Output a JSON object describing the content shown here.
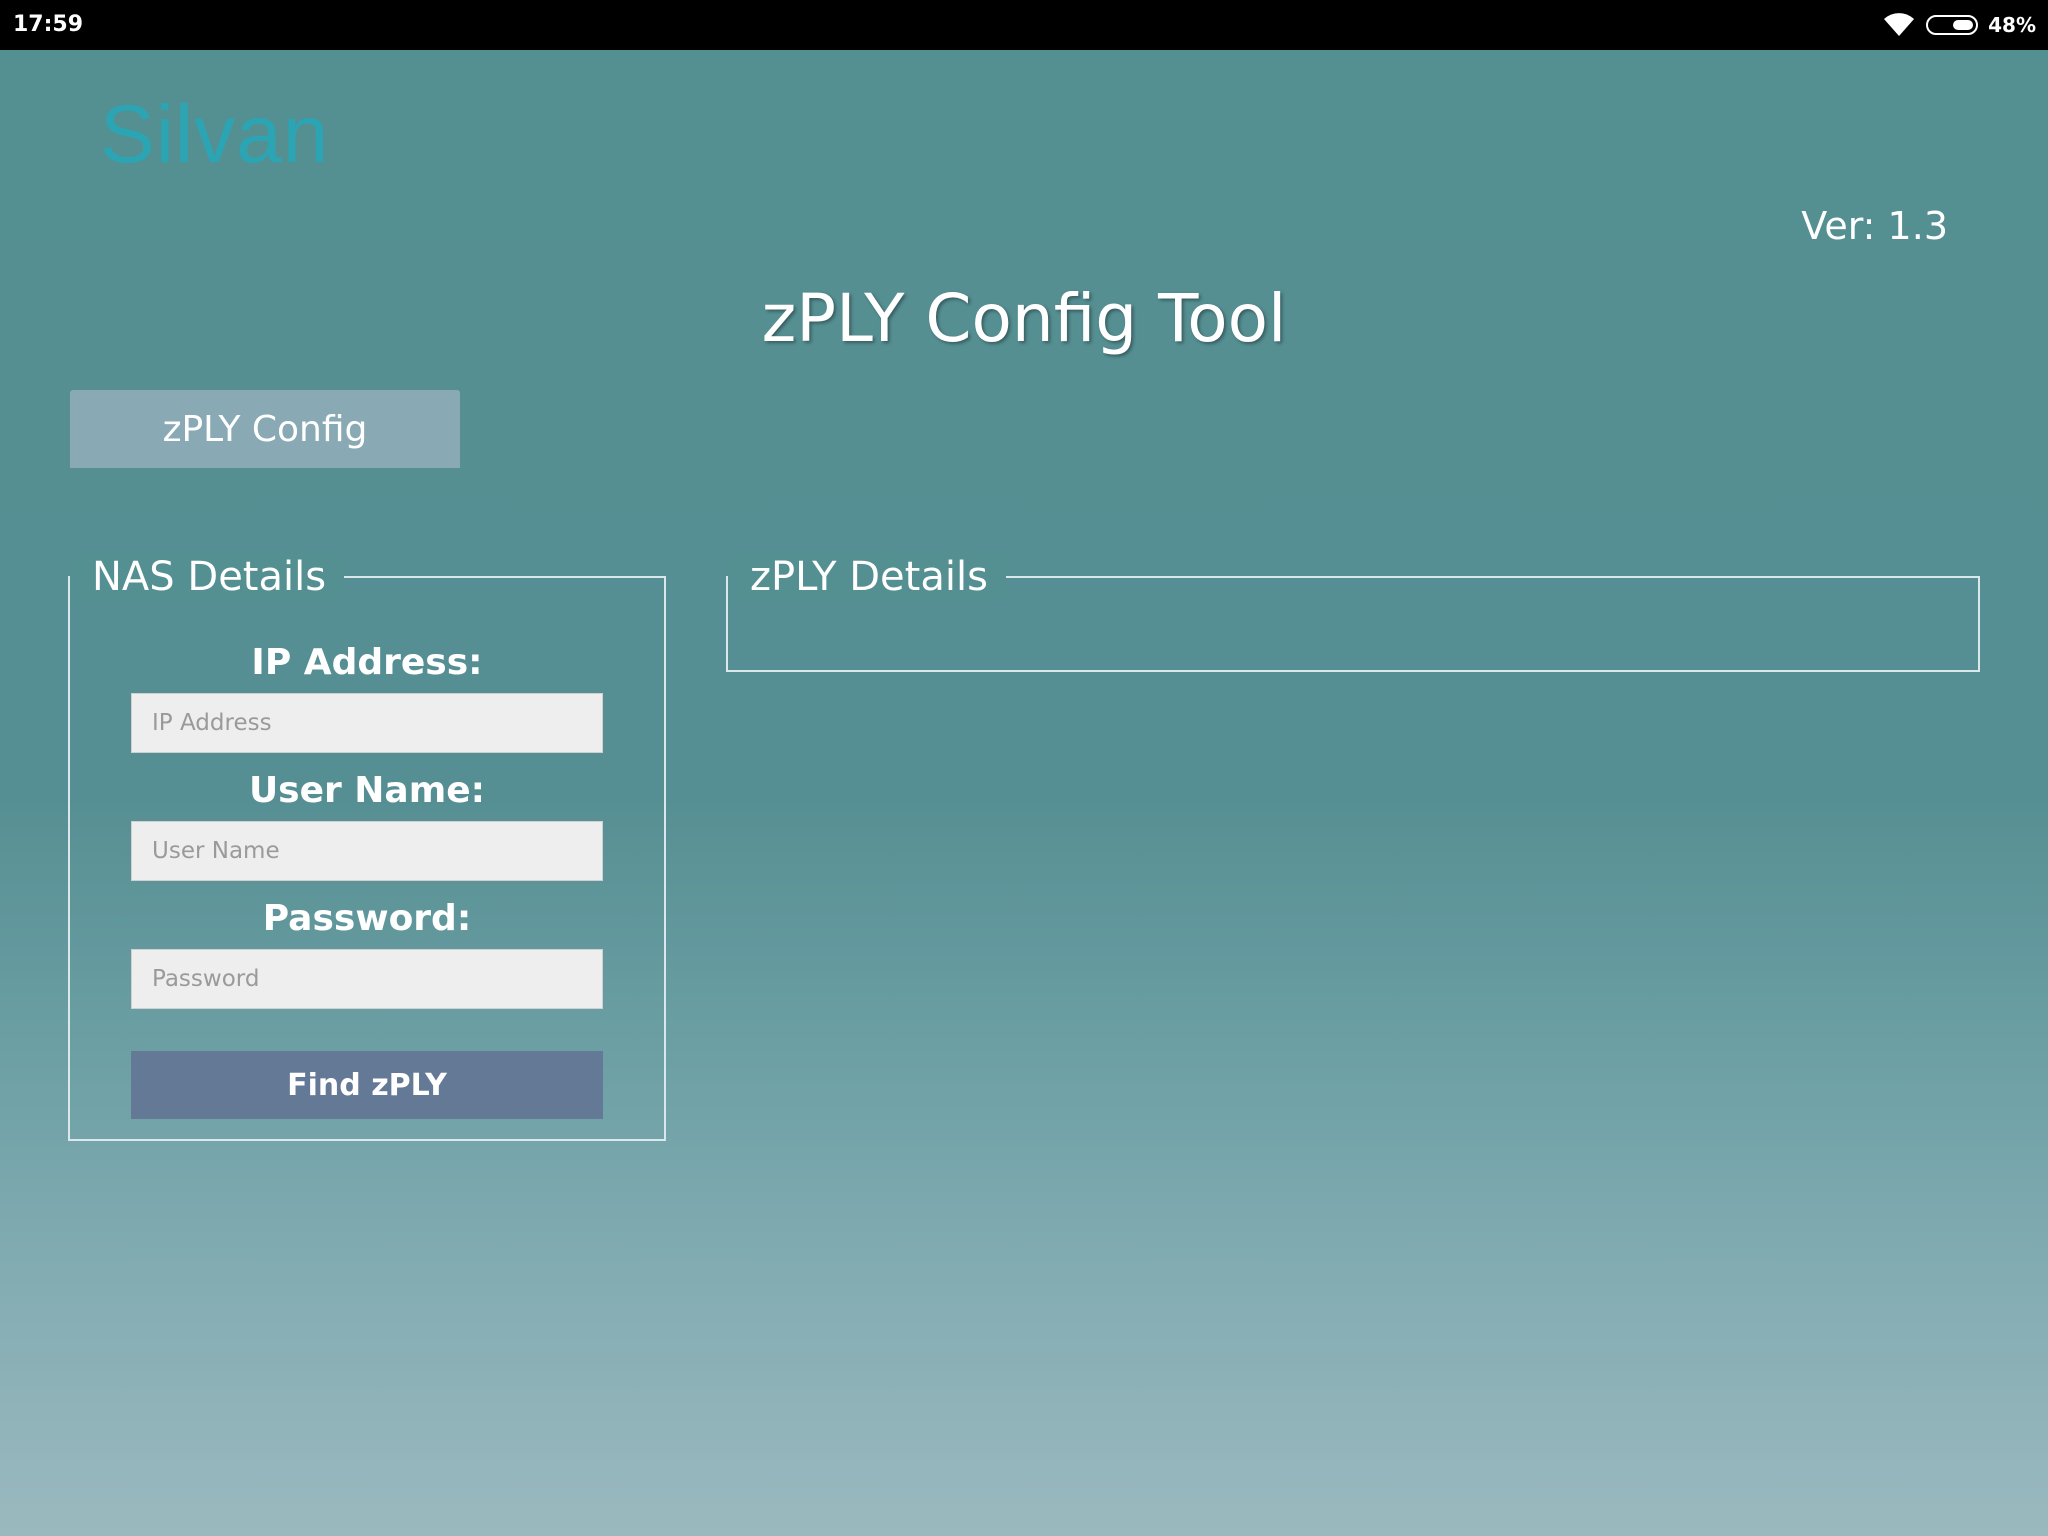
{
  "status_bar": {
    "time": "17:59",
    "battery_percent": "48%",
    "icons": [
      "wifi-icon",
      "battery-icon"
    ],
    "battery_level": 0.48
  },
  "app": {
    "logo": "Silvan",
    "version": "Ver: 1.3",
    "title": "zPLY Config Tool"
  },
  "tabs": [
    {
      "label": "zPLY Config"
    }
  ],
  "nas_details": {
    "legend": "NAS Details",
    "ip_label": "IP Address:",
    "ip_placeholder": "IP Address",
    "ip_value": "",
    "user_label": "User Name:",
    "user_placeholder": "User Name",
    "user_value": "",
    "password_label": "Password:",
    "password_placeholder": "Password",
    "password_value": "",
    "find_button": "Find zPLY"
  },
  "zply_details": {
    "legend": "zPLY Details"
  },
  "colors": {
    "logo": "#2ba5b3",
    "background_top": "#548f92",
    "background_bottom": "#9ab9bf",
    "tab": "#89aab4",
    "button": "#647996"
  }
}
